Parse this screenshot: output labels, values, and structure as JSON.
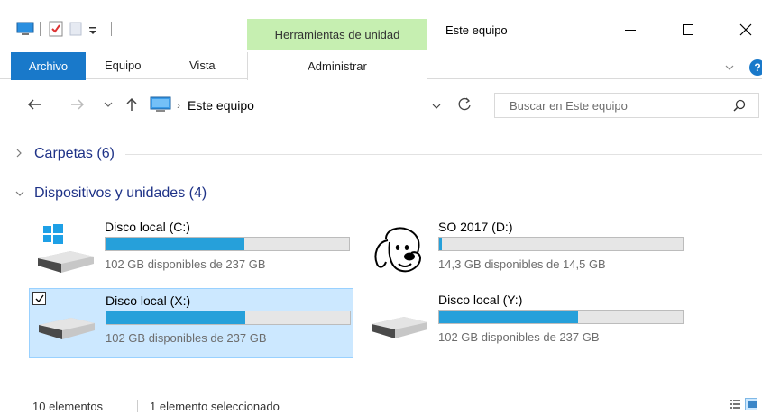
{
  "titlebar": {
    "tools_tab": "Herramientas de unidad",
    "title": "Este equipo",
    "minimize": "—",
    "maximize": "☐",
    "close": "✕"
  },
  "ribbon": {
    "file": "Archivo",
    "tabs": [
      "Equipo",
      "Vista"
    ],
    "manage": "Administrar",
    "help": "?"
  },
  "address": {
    "path": "Este equipo",
    "search_placeholder": "Buscar en Este equipo"
  },
  "groups": {
    "folders": "Carpetas (6)",
    "devices": "Dispositivos y unidades (4)"
  },
  "drives": [
    {
      "name": "Disco local (C:)",
      "free": "102 GB disponibles de 237 GB",
      "used_fraction": 0.57,
      "icon": "windows-drive-icon"
    },
    {
      "name": "SO 2017 (D:)",
      "free": "14,3 GB disponibles de 14,5 GB",
      "used_fraction": 0.01,
      "icon": "dog-drive-icon"
    },
    {
      "name": "Disco local (X:)",
      "free": "102 GB disponibles de 237 GB",
      "used_fraction": 0.57,
      "icon": "hard-drive-icon",
      "selected": true
    },
    {
      "name": "Disco local (Y:)",
      "free": "102 GB disponibles de 237 GB",
      "used_fraction": 0.57,
      "icon": "hard-drive-icon"
    }
  ],
  "status": {
    "count": "10 elementos",
    "selected": "1 elemento seleccionado"
  },
  "colors": {
    "accent": "#1979ca",
    "tools_tab": "#c6efb1",
    "selection": "#cce8ff",
    "bar_fill": "#26a0da",
    "group_label": "#1e3287"
  }
}
